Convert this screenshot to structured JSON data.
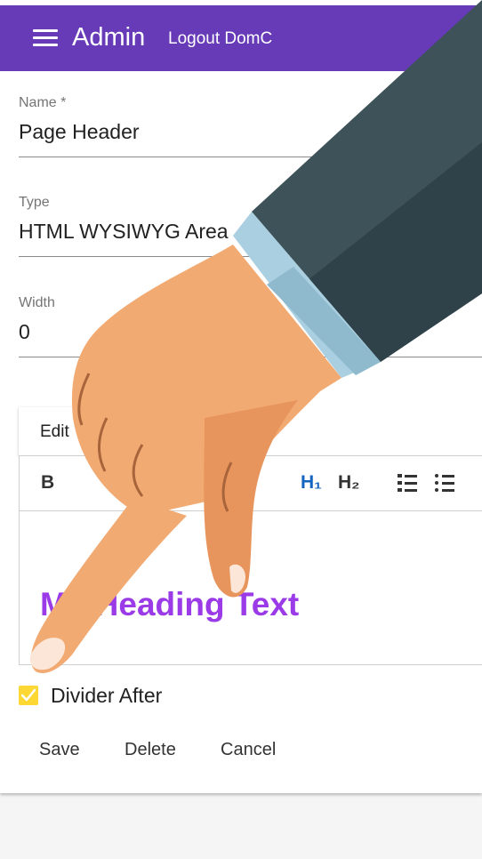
{
  "appbar": {
    "title": "Admin",
    "logout_label": "Logout DomC"
  },
  "form": {
    "name": {
      "label": "Name *",
      "value": "Page Header"
    },
    "type": {
      "label": "Type",
      "value": "HTML WYSIWYG Area"
    },
    "width": {
      "label": "Width",
      "value": "0"
    }
  },
  "editor": {
    "tab_label": "Edit",
    "toolbar": {
      "bold": "B",
      "h1": "H₁",
      "h2": "H₂"
    },
    "content_heading": "My Heading Text"
  },
  "divider_after": {
    "label": "Divider After",
    "checked": true
  },
  "actions": {
    "save": "Save",
    "delete": "Delete",
    "cancel": "Cancel"
  },
  "colors": {
    "appbar": "#673ab7",
    "checkbox": "#fdd835",
    "heading_text": "#9b3be8",
    "h1_button": "#1565c0"
  },
  "icons": [
    "menu-icon",
    "numbered-list-icon",
    "bullet-list-icon",
    "check-icon",
    "pointing-hand-illustration"
  ]
}
